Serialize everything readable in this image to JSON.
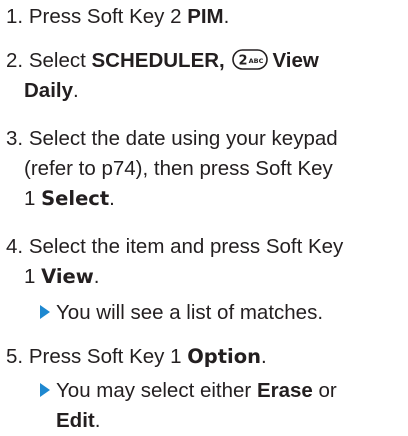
{
  "steps": [
    {
      "num": "1.",
      "pre": "Press Soft Key 2 ",
      "bold": "PIM",
      "post": "."
    },
    {
      "num": "2.",
      "pre": "Select ",
      "bold": "SCHEDULER,",
      "key_icon": "2-abc-key-icon",
      "key_icon_text": "2ABC",
      "bold2": "View",
      "line2_bold": "Daily",
      "line2_post": "."
    },
    {
      "num": "3.",
      "line1": "Select the date using your keypad",
      "line2": "(refer to p74), then press Soft Key",
      "line3_pre": "1 ",
      "line3_bold": "Select",
      "line3_post": "."
    },
    {
      "num": "4.",
      "line1": "Select the item and press Soft Key",
      "line2_pre": "1 ",
      "line2_bold": "View",
      "line2_post": "."
    },
    {
      "bullet": "You will see a list of matches.",
      "arrow_icon": "arrow-right-icon"
    },
    {
      "num": "5.",
      "pre": "Press Soft Key 1 ",
      "bold": "Option",
      "post": "."
    },
    {
      "bullet_pre": "You may select either ",
      "bullet_bold": "Erase",
      "bullet_mid": " or",
      "bullet_line2_bold": "Edit",
      "bullet_line2_post": ".",
      "arrow_icon": "arrow-right-icon"
    }
  ],
  "colors": {
    "text": "#231f20",
    "arrow": "#1e88d0"
  }
}
